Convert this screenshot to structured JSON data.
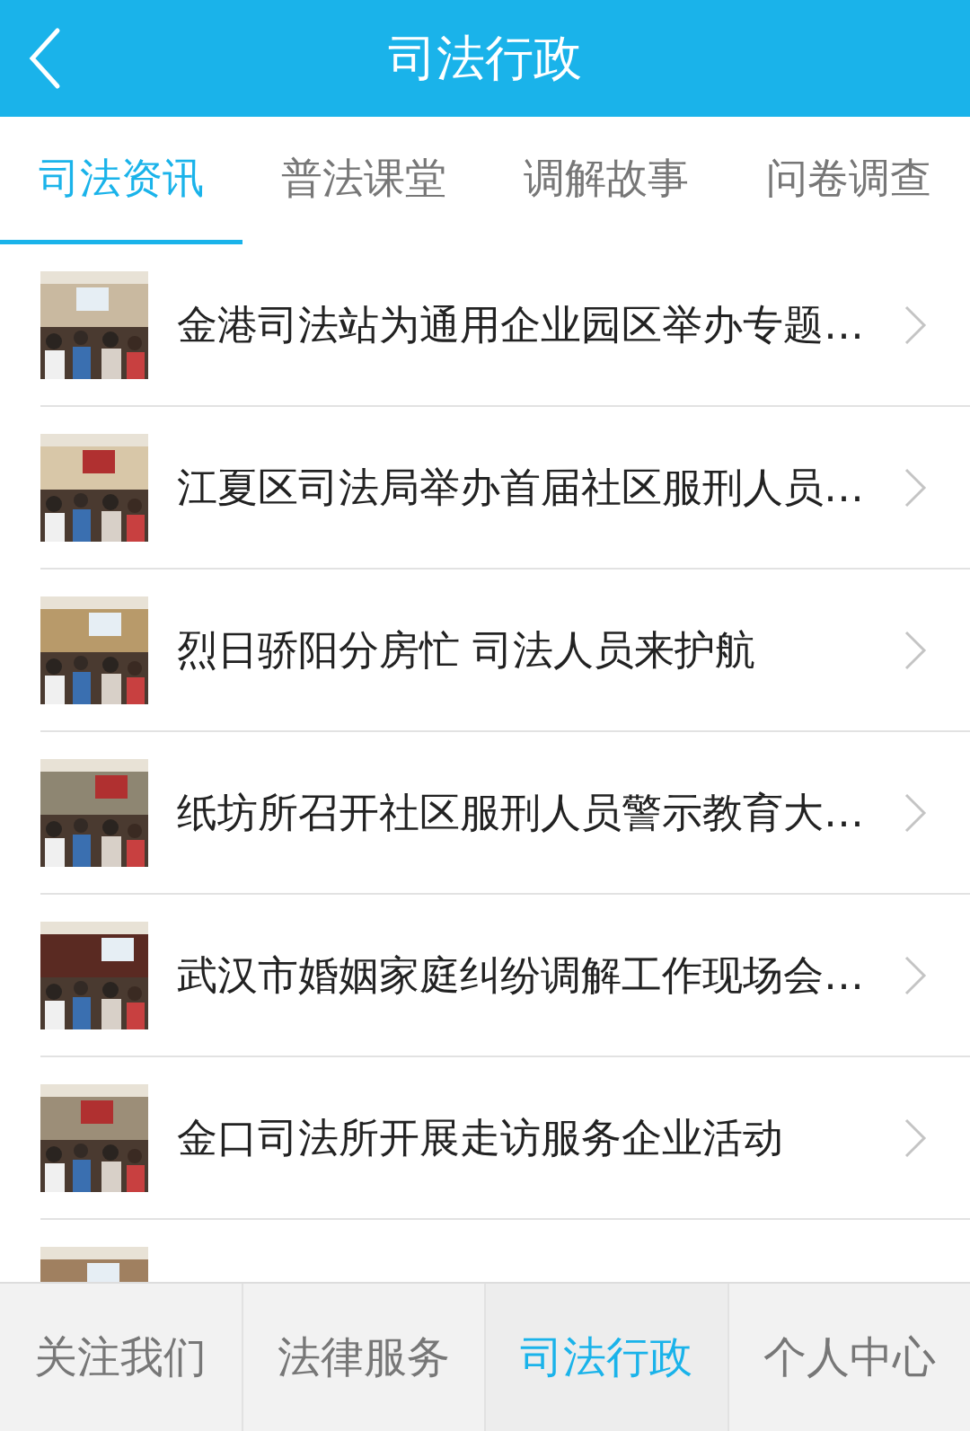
{
  "header": {
    "title": "司法行政"
  },
  "tabs": [
    {
      "label": "司法资讯",
      "selected": true
    },
    {
      "label": "普法课堂",
      "selected": false
    },
    {
      "label": "调解故事",
      "selected": false
    },
    {
      "label": "问卷调查",
      "selected": false
    }
  ],
  "articles": [
    {
      "title": "金港司法站为通用企业园区举办专题…",
      "thumbnail": {
        "kind": "picture"
      }
    },
    {
      "title": "江夏区司法局举办首届社区服刑人员…",
      "thumbnail": {
        "kind": "picture"
      }
    },
    {
      "title": "烈日骄阳分房忙 司法人员来护航",
      "thumbnail": {
        "kind": "picture"
      }
    },
    {
      "title": "纸坊所召开社区服刑人员警示教育大…",
      "thumbnail": {
        "kind": "picture"
      }
    },
    {
      "title": "武汉市婚姻家庭纠纷调解工作现场会…",
      "thumbnail": {
        "kind": "picture"
      }
    },
    {
      "title": "金口司法所开展走访服务企业活动",
      "thumbnail": {
        "kind": "picture"
      }
    },
    {
      "thumbnail": {
        "kind": "picture"
      }
    }
  ],
  "bottom_nav": [
    {
      "label": "关注我们",
      "selected": false
    },
    {
      "label": "法律服务",
      "selected": false
    },
    {
      "label": "司法行政",
      "selected": true
    },
    {
      "label": "个人中心",
      "selected": false
    }
  ]
}
